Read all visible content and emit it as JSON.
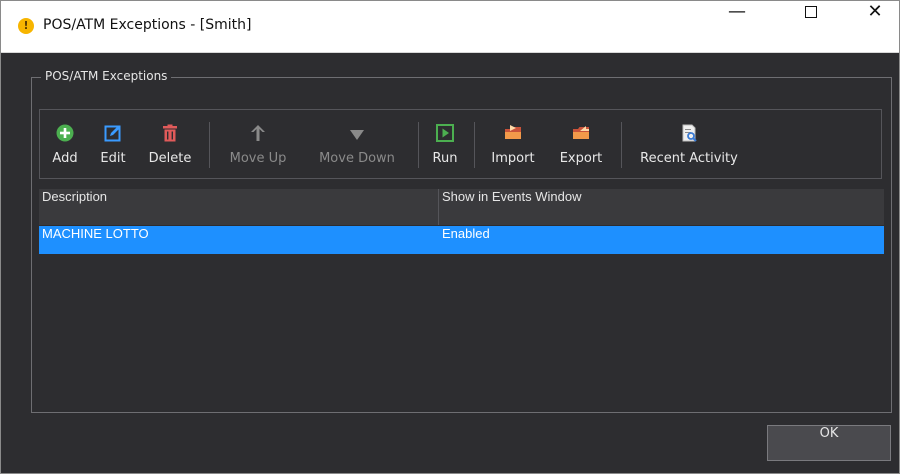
{
  "window": {
    "title": "POS/ATM Exceptions - [Smith]",
    "title_icon": "warning-icon",
    "controls": {
      "minimize": "—",
      "close": "✕"
    }
  },
  "group": {
    "legend": "POS/ATM Exceptions"
  },
  "toolbar": {
    "add": {
      "label": "Add",
      "icon": "add-icon",
      "color": "#4caf50"
    },
    "edit": {
      "label": "Edit",
      "icon": "edit-icon",
      "color": "#3a9bff"
    },
    "delete": {
      "label": "Delete",
      "icon": "trash-icon",
      "color": "#e05a5a"
    },
    "move_up": {
      "label": "Move Up",
      "icon": "arrow-up-icon",
      "disabled": true
    },
    "move_down": {
      "label": "Move Down",
      "icon": "arrow-down-icon",
      "disabled": true
    },
    "run": {
      "label": "Run",
      "icon": "play-icon",
      "color": "#4caf50"
    },
    "import": {
      "label": "Import",
      "icon": "folder-import-icon",
      "color": "#e8743b"
    },
    "export": {
      "label": "Export",
      "icon": "folder-export-icon",
      "color": "#e8743b"
    },
    "recent_activity": {
      "label": "Recent Activity",
      "icon": "report-search-icon"
    }
  },
  "grid": {
    "columns": [
      "Description",
      "Show in Events Window"
    ],
    "rows": [
      {
        "description": "MACHINE LOTTO",
        "show_in_events_window": "Enabled",
        "selected": true
      }
    ],
    "selection_color": "#1e90ff"
  },
  "footer": {
    "ok_label": "OK"
  }
}
